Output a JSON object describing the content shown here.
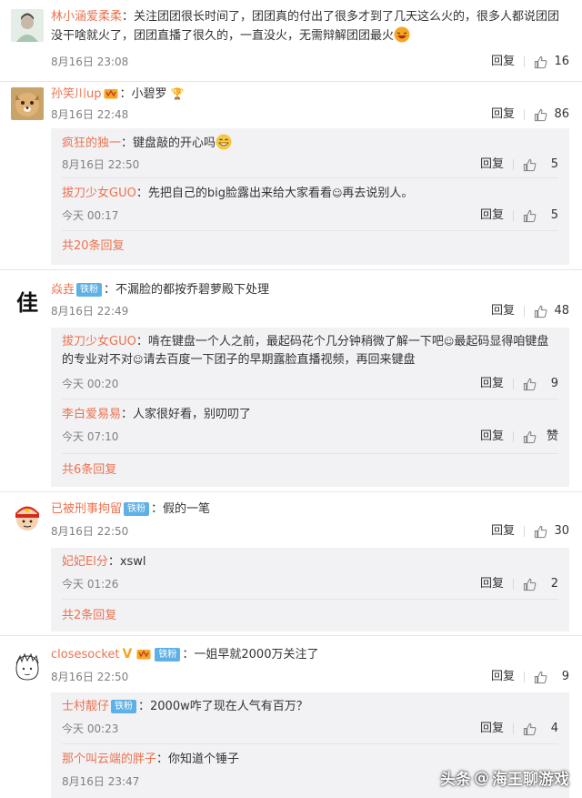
{
  "reply_label": "回复",
  "comments": [
    {
      "user": "林小涵爱柔柔",
      "text": "：关注团团很长时间了，团团真的付出了很多才到了几天这么火的，很多人都说团团",
      "text2": "没干啥就火了，团团直播了很久的，一直没火，无需辩解团团最火",
      "time": "8月16日 23:08",
      "likes": "16"
    },
    {
      "user": "孙笑川up",
      "text": "：小碧罗",
      "time": "8月16日 22:48",
      "likes": "86",
      "replies": [
        {
          "user": "疯狂的独一",
          "text": "：键盘敲的开心吗",
          "time": "8月16日 22:50",
          "likes": "5"
        },
        {
          "user": "拔刀少女GUO",
          "text": "：先把自己的big脸露出来给大家看看",
          "text_b": "再去说别人。",
          "time": "今天 00:17",
          "likes": "5"
        }
      ],
      "more": "共20条回复"
    },
    {
      "user": "焱垚",
      "badge": "铁粉",
      "text": "：不漏脸的都按乔碧萝殿下处理",
      "time": "8月16日 22:49",
      "likes": "48",
      "replies": [
        {
          "user": "拔刀少女GUO",
          "text": "：啃在键盘一个人之前，最起码花个几分钟稍微了解一下吧",
          "text_b": "最起码显得咱键盘",
          "text2": "的专业对不对",
          "text2_b": "请去百度一下团子的早期露脸直播视频，再回来键盘",
          "time": "今天 00:20",
          "likes": "9"
        },
        {
          "user": "李白爱易易",
          "text": "：人家很好看，别叨叨了",
          "time": "今天 07:10",
          "likes": "赞"
        }
      ],
      "more": "共6条回复"
    },
    {
      "user": "已被刑事拘留",
      "badge": "铁粉",
      "text": "：假的一笔",
      "time": "8月16日 22:50",
      "likes": "30",
      "replies": [
        {
          "user": "妃妃El分",
          "text": "：xswl",
          "time": "今天 01:26",
          "likes": "2"
        }
      ],
      "more": "共2条回复"
    },
    {
      "user": "closesocket",
      "badge": "铁粉",
      "text": "：一姐早就2000万关注了",
      "time": "8月16日 22:50",
      "likes": "9",
      "replies": [
        {
          "user": "士村靓仔",
          "badge": "铁粉",
          "text": "：2000w咋了现在人气有百万？",
          "time": "今天 00:23",
          "likes": "4"
        },
        {
          "user": "那个叫云端的胖子",
          "text": "：你知道个锤子",
          "time": "8月16日 23:47",
          "likes": ""
        }
      ]
    }
  ],
  "watermark": {
    "prefix": "头条",
    "at": "@",
    "name": "海王聊游戏"
  },
  "colors": {
    "username": "#eb7350",
    "badge": "#5fb0e5",
    "reply_bg": "#f2f2f5"
  },
  "icons": {
    "like": "thumbs-up-icon",
    "emoji": "laughing-emoji-icon",
    "vip": "vip-crown-icon"
  }
}
